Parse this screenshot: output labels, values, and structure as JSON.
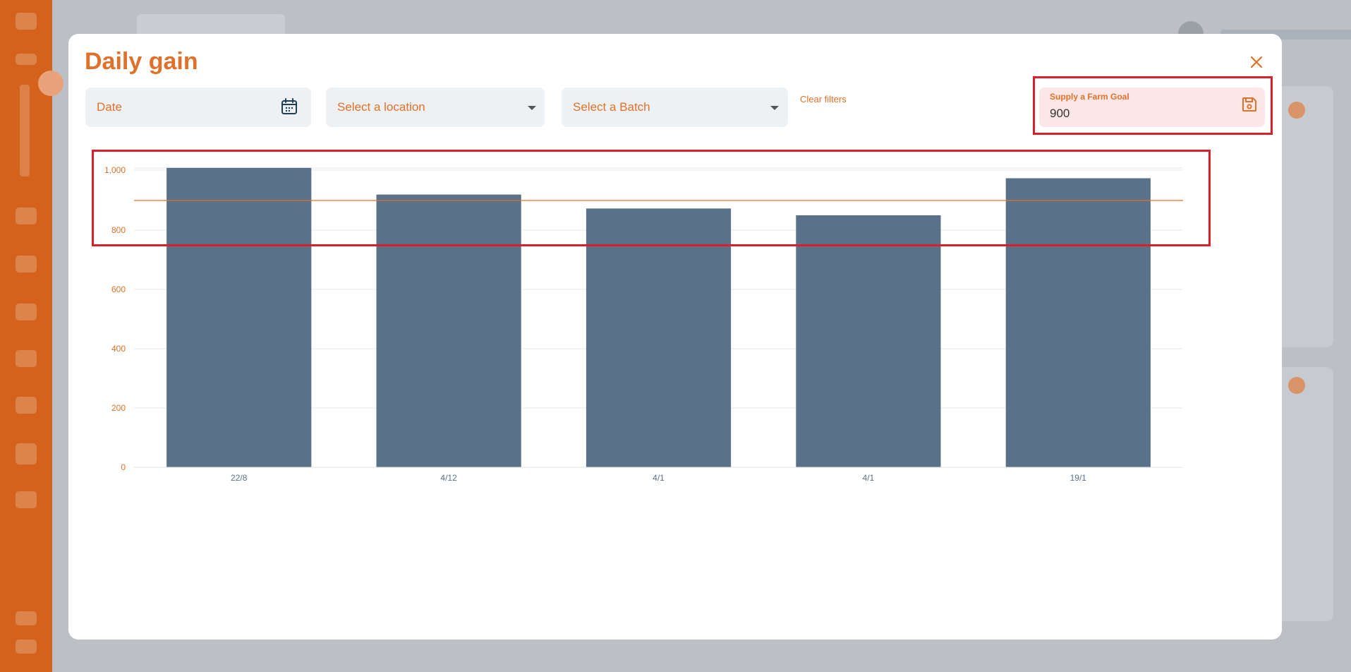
{
  "modal": {
    "title": "Daily gain"
  },
  "filters": {
    "date_placeholder": "Date",
    "location_placeholder": "Select a location",
    "batch_placeholder": "Select a Batch",
    "clear_label": "Clear filters"
  },
  "goal": {
    "label": "Supply a Farm Goal",
    "value": "900"
  },
  "colors": {
    "accent": "#e0712a",
    "bar": "#5a7289",
    "highlight": "#d9202a"
  },
  "icons": {
    "close": "close-icon",
    "calendar": "calendar-icon",
    "save": "save-icon",
    "dropdown": "chevron-down-icon"
  },
  "chart_data": {
    "type": "bar",
    "categories": [
      "22/8",
      "4/12",
      "4/1",
      "4/1",
      "19/1"
    ],
    "values": [
      1010,
      920,
      873,
      850,
      975
    ],
    "goal_line": 900,
    "ylim": [
      0,
      1000
    ],
    "yticks": [
      0,
      200,
      400,
      600,
      800,
      1000
    ],
    "ytick_labels": [
      "0",
      "200",
      "400",
      "600",
      "800",
      "1,000"
    ],
    "grid": true
  }
}
